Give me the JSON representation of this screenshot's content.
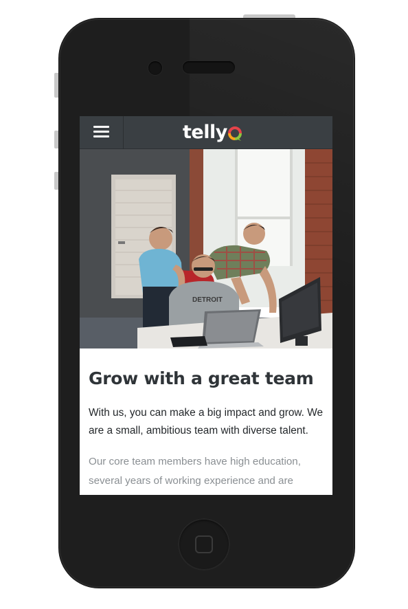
{
  "navbar": {
    "menu_icon": "hamburger-menu-icon",
    "logo_text": "telly",
    "logo_mark_icon": "speech-bubble-logo-icon",
    "background": "#3a3f43"
  },
  "hero": {
    "image": "team-photo-office",
    "shirt_text": "DETROIT"
  },
  "content": {
    "headline": "Grow with a great team",
    "lead_line_1": "With us, you can make a big impact and grow. We",
    "lead_line_2": "are a small, ambitious team with diverse talent.",
    "body_line_1": "Our core team members have high education,",
    "body_line_2": "several years of working experience and are"
  },
  "colors": {
    "headline": "#2f3438",
    "lead": "#23272a",
    "body": "#8a8f93",
    "logo_red": "#e5434a",
    "logo_green": "#8cc63f",
    "logo_orange": "#f7a21b",
    "phone_body": "#1e1e1e"
  }
}
